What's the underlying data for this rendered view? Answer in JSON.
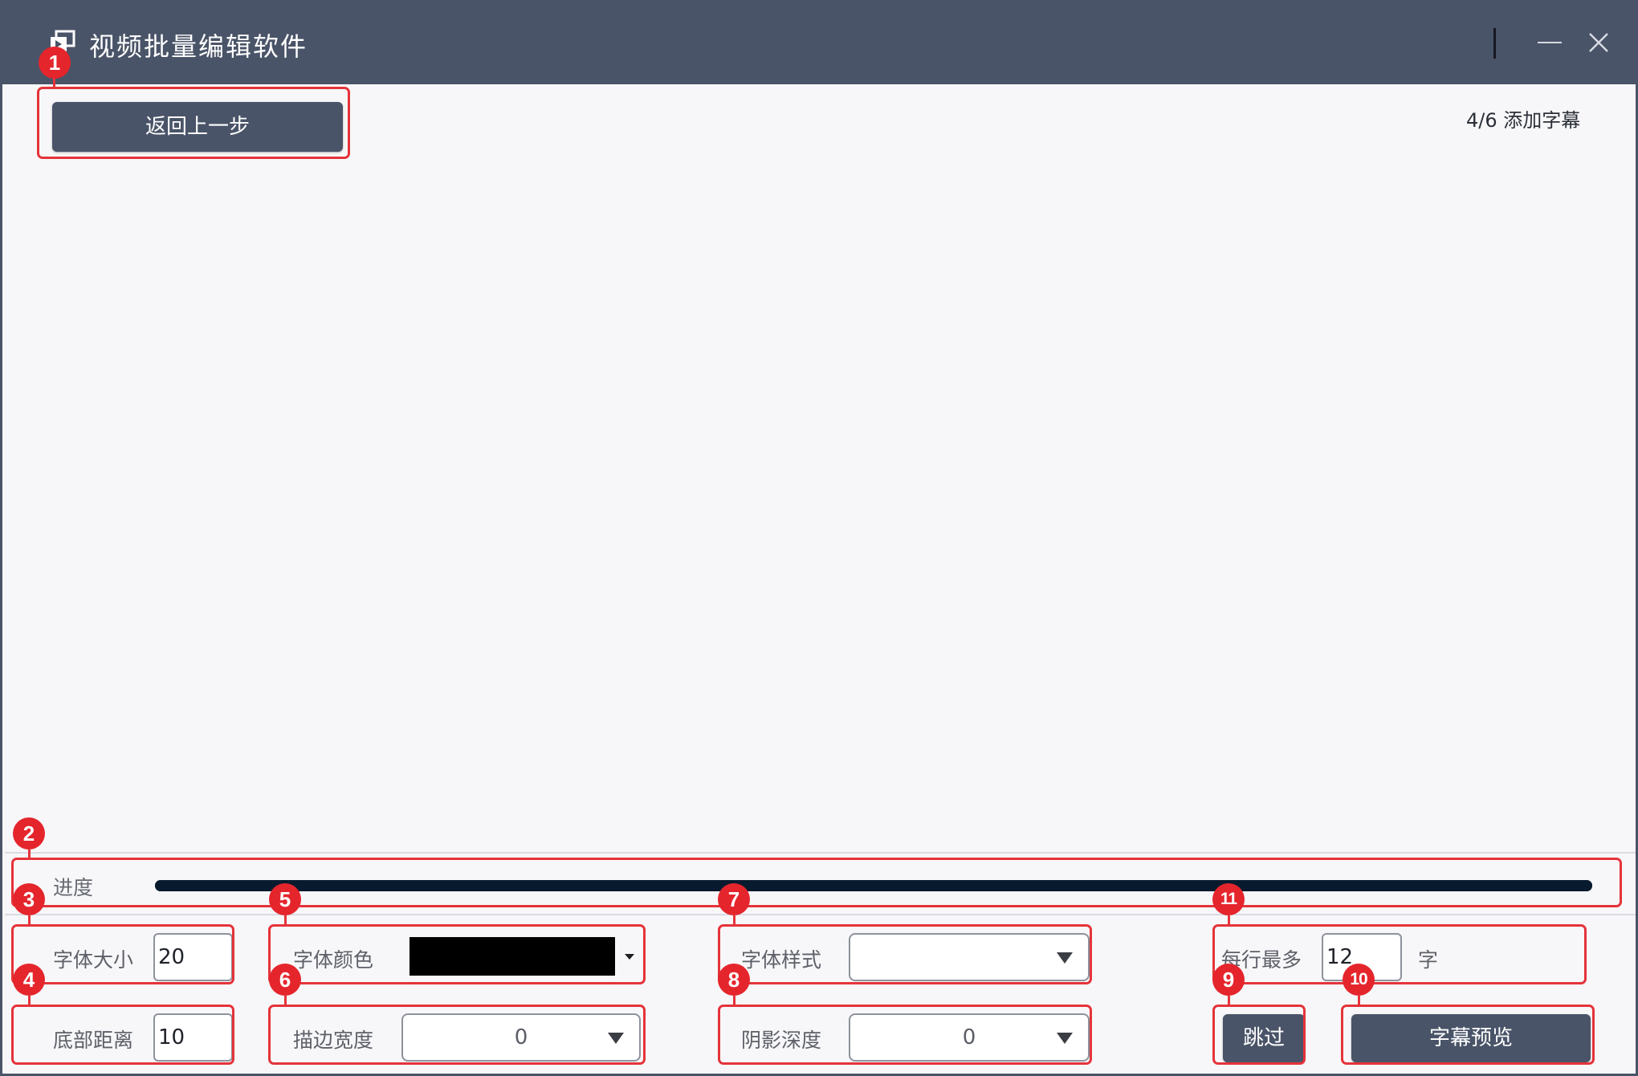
{
  "window": {
    "title": "视频批量编辑软件",
    "app_icon": "film-copy-icon",
    "minimize_icon": "minimize-icon",
    "close_icon": "close-icon"
  },
  "header": {
    "back_button": "返回上一步",
    "step_label": "4/6 添加字幕"
  },
  "progress": {
    "label": "进度",
    "value": 1.0
  },
  "settings": {
    "font_size": {
      "label": "字体大小",
      "value": "20"
    },
    "bottom_distance": {
      "label": "底部距离",
      "value": "10"
    },
    "font_color": {
      "label": "字体颜色",
      "value": "#000000"
    },
    "stroke_width": {
      "label": "描边宽度",
      "value": "0"
    },
    "font_style": {
      "label": "字体样式",
      "value": ""
    },
    "shadow_depth": {
      "label": "阴影深度",
      "value": "0"
    },
    "max_per_line": {
      "label": "每行最多",
      "value": "12",
      "unit": "字"
    }
  },
  "actions": {
    "skip_button": "跳过",
    "preview_button": "字幕预览"
  },
  "annotations": [
    "1",
    "2",
    "3",
    "4",
    "5",
    "6",
    "7",
    "8",
    "9",
    "10",
    "11"
  ],
  "colors": {
    "titlebar": "#4a5468",
    "button": "#4a5468",
    "annotation": "#e5252c",
    "progress": "#081a2e",
    "background": "#f7f7f9"
  }
}
